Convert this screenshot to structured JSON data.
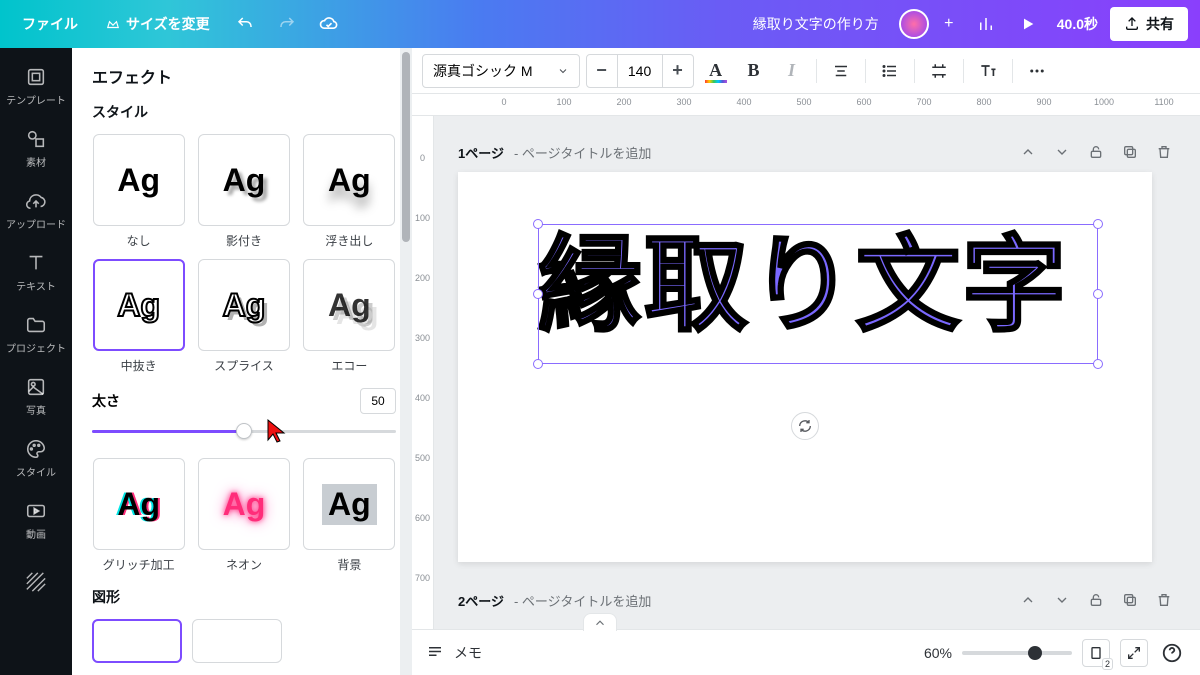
{
  "topbar": {
    "file": "ファイル",
    "resize": "サイズを変更",
    "doc_title": "縁取り文字の作り方",
    "duration": "40.0秒",
    "share": "共有"
  },
  "rail": {
    "templates": "テンプレート",
    "elements": "素材",
    "uploads": "アップロード",
    "text": "テキスト",
    "projects": "プロジェクト",
    "photos": "写真",
    "styles": "スタイル",
    "videos": "動画"
  },
  "panel": {
    "title": "エフェクト",
    "style_header": "スタイル",
    "shape_header": "図形",
    "thickness_label": "太さ",
    "thickness_value": "50",
    "tiles": {
      "none": "なし",
      "shadow": "影付き",
      "lift": "浮き出し",
      "outline": "中抜き",
      "splice": "スプライス",
      "echo": "エコー",
      "glitch": "グリッチ加工",
      "neon": "ネオン",
      "background": "背景"
    },
    "sample": "Ag"
  },
  "toolbar": {
    "font": "源真ゴシック M",
    "fontsize": "140"
  },
  "ruler_h": [
    "0",
    "100",
    "200",
    "300",
    "400",
    "500",
    "600",
    "700",
    "800",
    "900",
    "1000",
    "1100"
  ],
  "ruler_v": [
    "0",
    "100",
    "200",
    "300",
    "400",
    "500",
    "600",
    "700"
  ],
  "pages": {
    "p1_num": "1ページ",
    "p2_num": "2ページ",
    "add_title": "- ページタイトルを追加",
    "canvas_text": "縁取り文字"
  },
  "bottombar": {
    "notes": "メモ",
    "zoom": "60%",
    "page_count": "2"
  }
}
